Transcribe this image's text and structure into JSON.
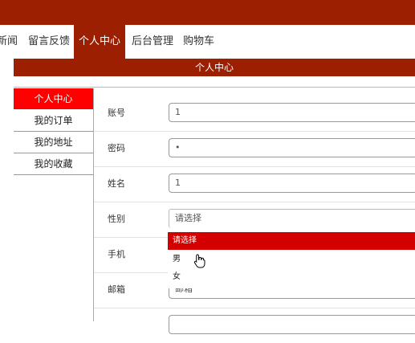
{
  "nav": {
    "items": [
      {
        "label": "新闻"
      },
      {
        "label": "留言反馈"
      },
      {
        "label": "个人中心",
        "active": true
      },
      {
        "label": "后台管理"
      },
      {
        "label": "购物车"
      }
    ]
  },
  "page_title": "个人中心",
  "sidebar": {
    "items": [
      {
        "label": "个人中心",
        "active": true
      },
      {
        "label": "我的订单"
      },
      {
        "label": "我的地址"
      },
      {
        "label": "我的收藏"
      }
    ]
  },
  "form": {
    "account_label": "账号",
    "account_value": "1",
    "password_label": "密码",
    "password_value": "•",
    "name_label": "姓名",
    "name_value": "1",
    "gender_label": "性别",
    "gender_value": "请选择",
    "phone_label": "手机",
    "email_label": "邮箱",
    "email_value": "邮箱"
  },
  "gender_dropdown": {
    "options": [
      "请选择",
      "男",
      "女"
    ],
    "highlighted": "请选择"
  },
  "colors": {
    "brand": "#9b1f00",
    "active_side": "#ff0000",
    "dropdown_highlight": "#d40000"
  }
}
